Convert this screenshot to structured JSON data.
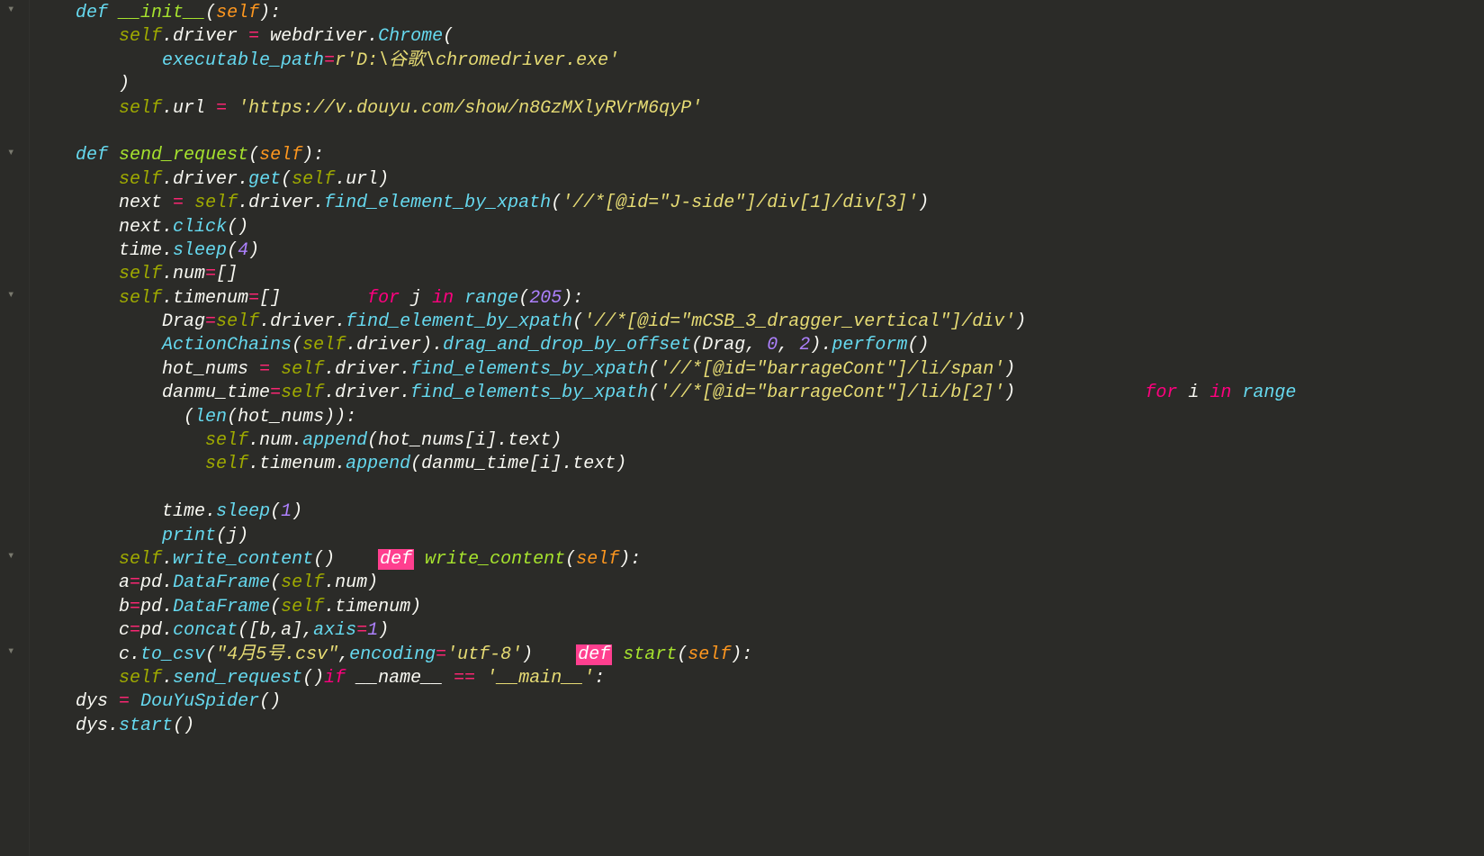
{
  "code": {
    "line1": "    def __init__(self):",
    "line2": "        self.driver = webdriver.Chrome(",
    "line3": "            executable_path=r'D:\\谷歌\\chromedriver.exe'",
    "line4": "        )",
    "line5": "        self.url = 'https://v.douyu.com/show/n8GzMXlyRVrM6qyP'",
    "line6": "",
    "line7": "    def send_request(self):",
    "line8": "        self.driver.get(self.url)",
    "line9": "        next = self.driver.find_element_by_xpath('//*[@id=\"J-side\"]/div[1]/div[3]')",
    "line10": "        next.click()",
    "line11": "        time.sleep(4)",
    "line12": "        self.num=[]",
    "line13": "        self.timenum=[]        for j in range(205):",
    "line14": "            Drag=self.driver.find_element_by_xpath('//*[@id=\"mCSB_3_dragger_vertical\"]/div')",
    "line15": "            ActionChains(self.driver).drag_and_drop_by_offset(Drag, 0, 2).perform()",
    "line16": "            hot_nums = self.driver.find_elements_by_xpath('//*[@id=\"barrageCont\"]/li/span')",
    "line17": "            danmu_time=self.driver.find_elements_by_xpath('//*[@id=\"barrageCont\"]/li/b[2]')            for i in range",
    "line18": "              (len(hot_nums)):",
    "line19": "                self.num.append(hot_nums[i].text)",
    "line20": "                self.timenum.append(danmu_time[i].text)",
    "line21": "",
    "line22": "            time.sleep(1)",
    "line23": "            print(j)",
    "line24": "        self.write_content()    def write_content(self):",
    "line25": "        a=pd.DataFrame(self.num)",
    "line26": "        b=pd.DataFrame(self.timenum)",
    "line27": "        c=pd.concat([b,a],axis=1)",
    "line28": "        c.to_csv(\"4月5号.csv\",encoding='utf-8')    def start(self):",
    "line29": "        self.send_request()if __name__ == '__main__':",
    "line30": "    dys = DouYuSpider()",
    "line31": "    dys.start()"
  },
  "fold_arrows": [
    "▾",
    "▾",
    "▾",
    "▾",
    "▾"
  ]
}
